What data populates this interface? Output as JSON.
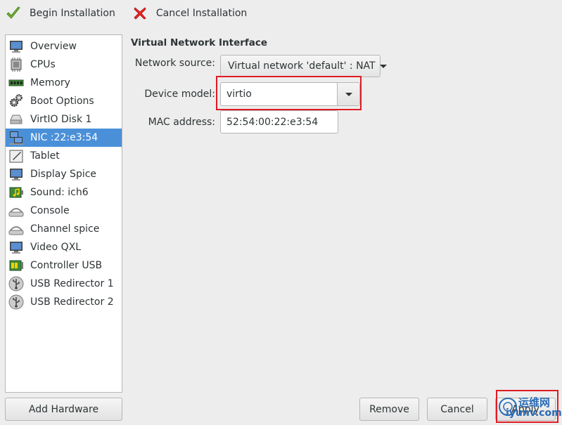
{
  "toolbar": {
    "begin_label": "Begin Installation",
    "cancel_label": "Cancel Installation"
  },
  "sidebar": {
    "items": [
      {
        "label": "Overview",
        "icon": "monitor-icon"
      },
      {
        "label": "CPUs",
        "icon": "cpu-icon"
      },
      {
        "label": "Memory",
        "icon": "memory-icon"
      },
      {
        "label": "Boot Options",
        "icon": "gears-icon"
      },
      {
        "label": "VirtIO Disk 1",
        "icon": "disk-icon"
      },
      {
        "label": "NIC :22:e3:54",
        "icon": "network-icon"
      },
      {
        "label": "Tablet",
        "icon": "tablet-icon"
      },
      {
        "label": "Display Spice",
        "icon": "display-icon"
      },
      {
        "label": "Sound: ich6",
        "icon": "sound-card-icon"
      },
      {
        "label": "Console",
        "icon": "serial-icon"
      },
      {
        "label": "Channel spice",
        "icon": "serial-icon"
      },
      {
        "label": "Video QXL",
        "icon": "display-icon"
      },
      {
        "label": "Controller USB",
        "icon": "controller-icon"
      },
      {
        "label": "USB Redirector 1",
        "icon": "usb-icon"
      },
      {
        "label": "USB Redirector 2",
        "icon": "usb-icon"
      }
    ],
    "selected_index": 5
  },
  "main": {
    "section_title": "Virtual Network Interface",
    "network_source_label": "Network source:",
    "network_source_value": "Virtual network 'default' : NAT",
    "device_model_label": "Device model:",
    "device_model_value": "virtio",
    "mac_label": "MAC address:",
    "mac_value": "52:54:00:22:e3:54"
  },
  "buttons": {
    "add_hardware": "Add Hardware",
    "remove": "Remove",
    "cancel": "Cancel",
    "apply": "Apply"
  },
  "watermark": {
    "line1": "运维网",
    "line2": "iyunv.com"
  },
  "colors": {
    "selection": "#4a90d9",
    "highlight_box": "#e01b24",
    "check_green": "#73b13b",
    "cancel_red": "#cc0000"
  }
}
